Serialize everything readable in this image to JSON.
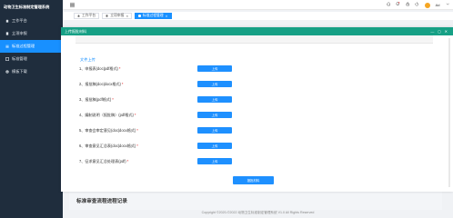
{
  "app": {
    "title": "动物卫生标准制定管理系统"
  },
  "sidebar": {
    "items": [
      {
        "label": "工作平台",
        "icon": "home-icon",
        "active": false
      },
      {
        "label": "立项申报",
        "icon": "file-icon",
        "active": false
      },
      {
        "label": "标准过程管理",
        "icon": "process-icon",
        "active": true
      },
      {
        "label": "标准管理",
        "icon": "list-icon",
        "active": false
      },
      {
        "label": "模板下载",
        "icon": "download-icon",
        "active": false
      }
    ]
  },
  "header": {
    "user_name": "Ad",
    "icons": [
      "home-icon",
      "bell-icon",
      "lock-icon",
      "power-icon",
      "avatar"
    ]
  },
  "tabs": [
    {
      "label": "工作平台",
      "active": false,
      "closable": false
    },
    {
      "label": "立项申报",
      "active": false,
      "closable": true
    },
    {
      "label": "标准过程管理",
      "active": true,
      "closable": true
    }
  ],
  "modal": {
    "title": "上传报批材料",
    "section_title": "文件上传",
    "documents": [
      {
        "label": "1、申报表(doc|pdf格式)",
        "required": "*"
      },
      {
        "label": "2、报批稿(doc|docx格式)",
        "required": "*"
      },
      {
        "label": "3、报批稿(pdf格式)",
        "required": "*"
      },
      {
        "label": "4、编制说明（报批稿）(pdf格式)",
        "required": "*"
      },
      {
        "label": "5、审查会审定意见(doc|docx格式)",
        "required": "*"
      },
      {
        "label": "6、审查意见汇总表(doc|docx格式)",
        "required": "*"
      },
      {
        "label": "7、征求意见汇总处理表(pdf)",
        "required": "*"
      }
    ],
    "upload_label": "上传",
    "submit_label": "报批材料",
    "controls": [
      "—",
      "◻",
      "✕"
    ]
  },
  "record_panel": {
    "title": "标准审查流程进程记录"
  },
  "footer": {
    "text": "Copyright ©2020-©2022 动物卫生标准制定管理系统 V1.0 All Rights Reserved"
  },
  "colors": {
    "sidebar": "#1f2d3d",
    "accent": "#1890ff",
    "modal_header": "#16a085",
    "required": "#e02020"
  }
}
